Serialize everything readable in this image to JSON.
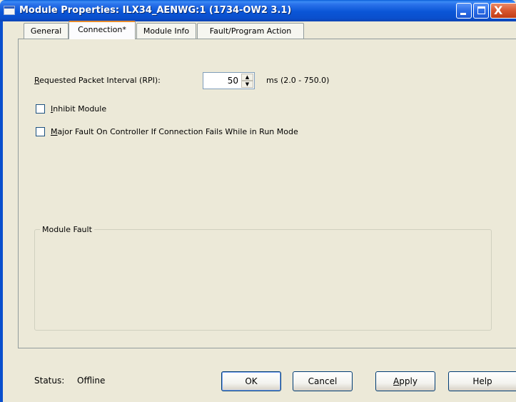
{
  "window": {
    "title": "Module Properties: ILX34_AENWG:1 (1734-OW2 3.1)",
    "controls": {
      "minimize_icon": "minimize-icon",
      "maximize_icon": "maximize-icon",
      "close_icon": "close-icon",
      "close_glyph": "X"
    }
  },
  "tabs": [
    {
      "label": "General"
    },
    {
      "label": "Connection*"
    },
    {
      "label": "Module Info"
    },
    {
      "label": "Fault/Program Action"
    }
  ],
  "connection": {
    "rpi_label": "Requested Packet Interval (RPI):",
    "rpi_value": "50",
    "rpi_range": "ms (2.0 - 750.0)",
    "spin_up": "▲",
    "spin_down": "▼",
    "inhibit_label": "Inhibit Module",
    "inhibit_checked": false,
    "major_fault_label": "Major Fault On Controller If Connection Fails While in Run Mode",
    "major_fault_checked": false,
    "module_fault_title": "Module Fault"
  },
  "status": {
    "label": "Status:",
    "value": "Offline"
  },
  "buttons": {
    "ok": "OK",
    "cancel": "Cancel",
    "apply": "Apply",
    "help": "Help"
  },
  "colors": {
    "titlebar": "#0a55d6",
    "active_tab_accent": "#e68b2c",
    "dialog_bg": "#ece9d8"
  }
}
